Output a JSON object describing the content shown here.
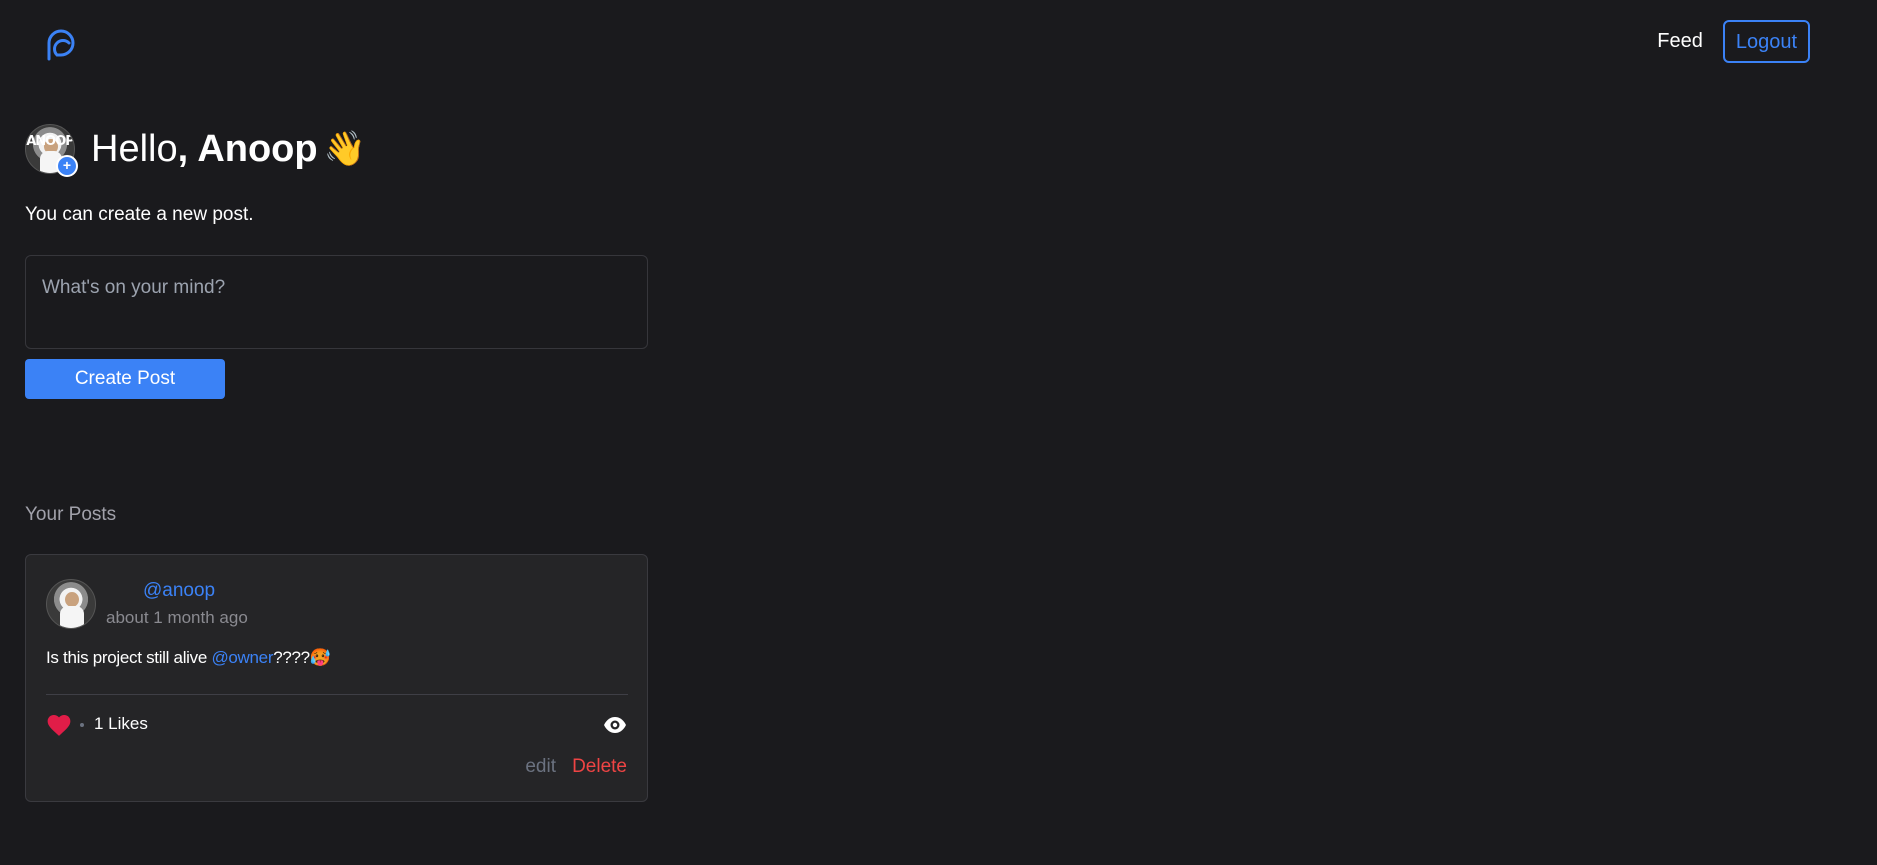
{
  "header": {
    "logo_icon": "app-logo-icon",
    "nav_feed": "Feed",
    "nav_logout": "Logout"
  },
  "greeting": {
    "avatar_text": "ANOOP",
    "avatar_add_icon": "plus-icon",
    "hello": "Hello",
    "name": ", Anoop",
    "wave_emoji": "👋"
  },
  "composer": {
    "subtitle": "You can create a new post.",
    "placeholder": "What's on your mind?",
    "value": "",
    "submit_label": "Create Post"
  },
  "posts_section": {
    "title": "Your Posts",
    "posts": [
      {
        "handle": "@anoop",
        "time": "about 1 month ago",
        "body_prefix": "Is this project still alive ",
        "mention": "@owner",
        "body_suffix": "????🥵",
        "likes_text": "1 Likes",
        "liked": true,
        "edit_label": "edit",
        "delete_label": "Delete"
      }
    ]
  },
  "colors": {
    "background": "#1a1a1d",
    "card": "#252527",
    "accent": "#3b82f6",
    "danger": "#ef4444",
    "like": "#e11d48"
  }
}
